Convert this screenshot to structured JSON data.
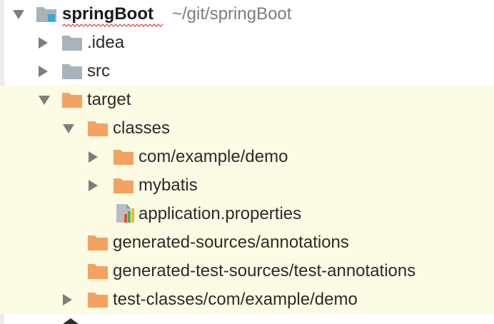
{
  "project": {
    "name": "springBoot",
    "path": "~/git/springBoot"
  },
  "items": [
    {
      "label": ".idea"
    },
    {
      "label": "src"
    },
    {
      "label": "target"
    },
    {
      "label": "classes"
    },
    {
      "label": "com/example/demo"
    },
    {
      "label": "mybatis"
    },
    {
      "label": "application.properties"
    },
    {
      "label": "generated-sources/annotations"
    },
    {
      "label": "generated-test-sources/test-annotations"
    },
    {
      "label": "test-classes/com/example/demo"
    }
  ],
  "colors": {
    "folder_gray": "#a8b2bb",
    "folder_orange": "#f4a261",
    "highlight": "#fcfbe3",
    "module_blue": "#3aa6d8"
  },
  "icons": {
    "module": "module-folder-icon",
    "folder": "folder-icon",
    "excluded_folder": "excluded-folder-icon",
    "properties": "properties-file-icon"
  }
}
